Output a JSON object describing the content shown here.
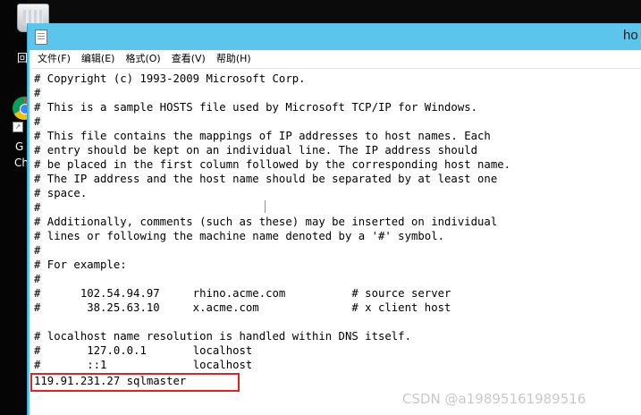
{
  "desktop": {
    "chars": [
      "回",
      "G",
      "Ch"
    ]
  },
  "window": {
    "title": "ho"
  },
  "menu": [
    "文件(F)",
    "编辑(E)",
    "格式(O)",
    "查看(V)",
    "帮助(H)"
  ],
  "editor": {
    "lines": [
      "# Copyright (c) 1993-2009 Microsoft Corp.",
      "#",
      "# This is a sample HOSTS file used by Microsoft TCP/IP for Windows.",
      "#",
      "# This file contains the mappings of IP addresses to host names. Each",
      "# entry should be kept on an individual line. The IP address should",
      "# be placed in the first column followed by the corresponding host name.",
      "# The IP address and the host name should be separated by at least one",
      "# space.",
      "#",
      "# Additionally, comments (such as these) may be inserted on individual",
      "# lines or following the machine name denoted by a '#' symbol.",
      "#",
      "# For example:",
      "#",
      "#      102.54.94.97     rhino.acme.com          # source server",
      "#       38.25.63.10     x.acme.com              # x client host",
      "",
      "# localhost name resolution is handled within DNS itself.",
      "#\t127.0.0.1       localhost",
      "#\t::1             localhost",
      "119.91.231.27 sqlmaster"
    ]
  },
  "watermark": "CSDN @a19895161989516",
  "colors": {
    "titlebar": "#5cc5eb",
    "highlight": "#e8211f"
  }
}
